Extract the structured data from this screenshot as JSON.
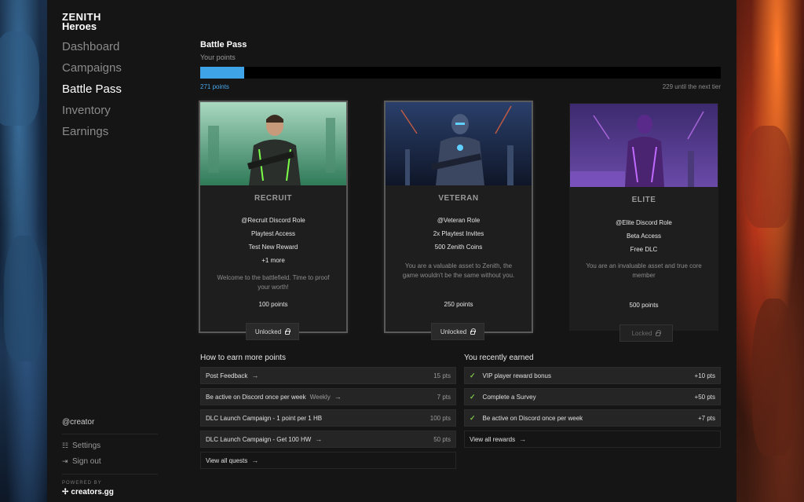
{
  "brand": {
    "line1": "ZENITH",
    "line2": "Heroes"
  },
  "nav": [
    {
      "label": "Dashboard",
      "active": false
    },
    {
      "label": "Campaigns",
      "active": false
    },
    {
      "label": "Battle Pass",
      "active": true
    },
    {
      "label": "Inventory",
      "active": false
    },
    {
      "label": "Earnings",
      "active": false
    }
  ],
  "user": {
    "handle": "@creator"
  },
  "sidebar_links": {
    "settings": "Settings",
    "signout": "Sign out"
  },
  "powered": {
    "label": "POWERED BY",
    "name": "creators.gg"
  },
  "battle_pass": {
    "title": "Battle Pass",
    "subtitle": "Your points",
    "points_label": "271 points",
    "next_tier": "229 until the next tier",
    "progress_fraction": 0.085,
    "progress_color": "#3fa3e8"
  },
  "tiers": [
    {
      "name": "RECRUIT",
      "perks": [
        "@Recruit Discord Role",
        "Playtest Access",
        "Test New Reward",
        "+1 more"
      ],
      "desc": "Welcome to the battlefield. Time to proof your worth!",
      "cost": "100 points",
      "status": "Unlocked",
      "unlocked": true
    },
    {
      "name": "VETERAN",
      "perks": [
        "@Veteran Role",
        "2x Playtest Invites",
        "500 Zenith Coins"
      ],
      "desc": "You are a valuable asset to Zenith, the game wouldn't be the same without you.",
      "cost": "250 points",
      "status": "Unlocked",
      "unlocked": true
    },
    {
      "name": "ELITE",
      "perks": [
        "@Elite Discord Role",
        "Beta Access",
        "Free DLC"
      ],
      "desc": "You are an invaluable asset and true core member",
      "cost": "500 points",
      "status": "Locked",
      "unlocked": false
    }
  ],
  "earn": {
    "heading": "How to earn more points",
    "items": [
      {
        "label": "Post Feedback",
        "tag": "",
        "pts": "15 pts"
      },
      {
        "label": "Be active on Discord once per week",
        "tag": "Weekly",
        "pts": "7 pts"
      },
      {
        "label": "DLC Launch Campaign - 1 point per 1 HB",
        "tag": "",
        "pts": "100 pts"
      },
      {
        "label": "DLC Launch Campaign - Get 100 HW",
        "tag": "",
        "pts": "50 pts"
      }
    ],
    "view_all": "View all quests"
  },
  "earned": {
    "heading": "You recently earned",
    "items": [
      {
        "label": "VIP player reward bonus",
        "pts": "+10 pts"
      },
      {
        "label": "Complete a Survey",
        "pts": "+50 pts"
      },
      {
        "label": "Be active on Discord once per week",
        "pts": "+7 pts"
      }
    ],
    "view_all": "View all rewards"
  }
}
